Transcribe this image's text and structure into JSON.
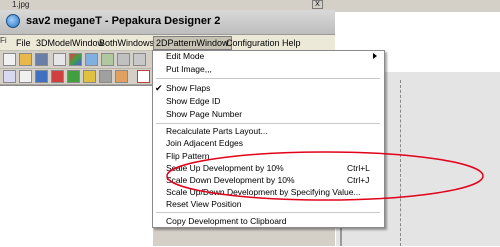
{
  "background": {
    "file_title": "1.jpg",
    "left_fragment": "Fi",
    "button_glyph": "X"
  },
  "window": {
    "title": "sav2 meganeT - Pepakura Designer 2"
  },
  "menubar": {
    "items": [
      "File",
      "3DModelWindow",
      "BothWindows",
      "2DPatternWindow",
      "Configuration",
      "Help"
    ],
    "active_index": 3
  },
  "dropdown": {
    "items": [
      {
        "label": "Edit Mode",
        "submenu": true
      },
      {
        "label": "Put Image,,,"
      },
      {
        "label": "Show Flaps",
        "checked": true
      },
      {
        "label": "Show Edge ID"
      },
      {
        "label": "Show Page Number"
      },
      {
        "label": "Recalculate Parts Layout..."
      },
      {
        "label": "Join Adjacent Edges"
      },
      {
        "label": "Flip Pattern"
      },
      {
        "label": "Scale Up Development by 10%",
        "shortcut": "Ctrl+L"
      },
      {
        "label": "Scale Down Development by 10%",
        "shortcut": "Ctrl+J"
      },
      {
        "label": "Scale Up/Down Development by Specifying Value..."
      },
      {
        "label": "Reset View Position"
      },
      {
        "label": "Copy Development to Clipboard"
      }
    ],
    "check_glyph": "✔",
    "highlight_color": "#e2001a"
  }
}
